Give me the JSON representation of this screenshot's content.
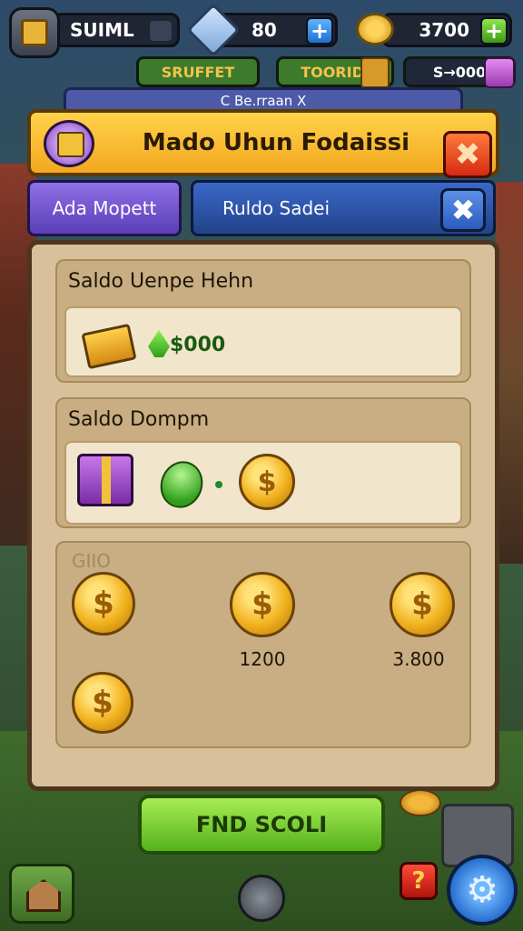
{
  "hud": {
    "player_name": "SUIML",
    "gems": "80",
    "gems_plus": "+",
    "coins": "3700",
    "coins_plus": "+"
  },
  "chips": {
    "shop": "SRUFFET",
    "mid": "TOORIDI",
    "right": "S→000"
  },
  "dialog": {
    "tab": "С Be.rraan Х",
    "title": "Mado Uhun Fodaissi",
    "close_symbol": "✖",
    "tab_left": "Ada Mopett",
    "tab_right": "Ruldo Sadei",
    "tab_close_symbol": "✖"
  },
  "sections": {
    "first": {
      "label": "Saldo Uenpe Hehn",
      "reward": "$000"
    },
    "second": {
      "label": "Saldo Dompm"
    },
    "third": {
      "label": "GIIO",
      "coin_amounts": [
        "1200",
        "3.800"
      ]
    }
  },
  "buttons": {
    "find": "FND SCOLI",
    "help": "?",
    "settings": "⚙"
  },
  "icons": {
    "avatar": "crate-icon",
    "gem": "gem-icon",
    "coin": "coin-icon",
    "chest_gold": "gold-chest-icon",
    "chest_purple": "purple-chest-icon",
    "home": "home-icon",
    "compass": "compass-icon"
  }
}
